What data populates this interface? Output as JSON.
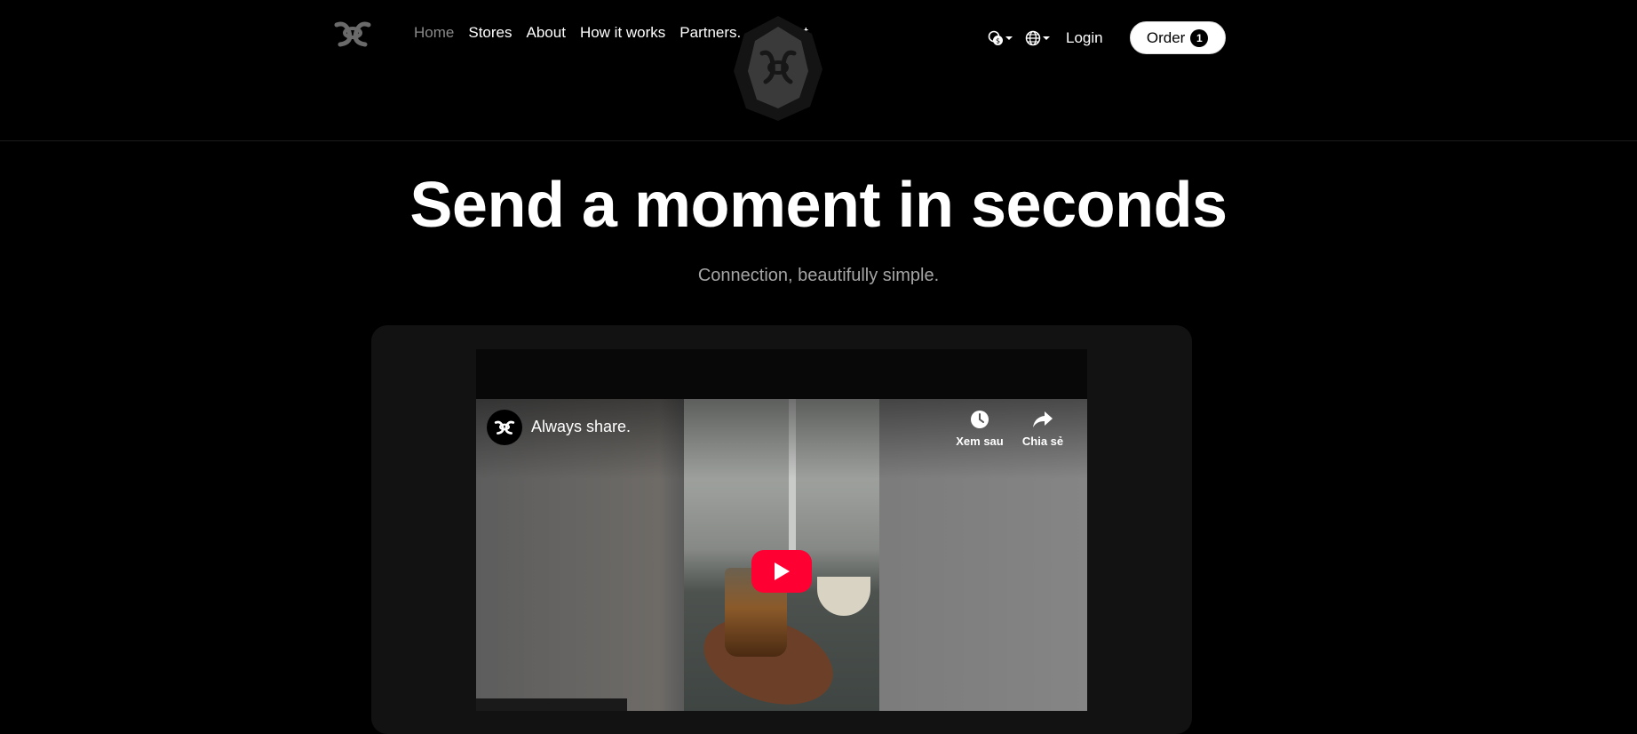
{
  "nav": {
    "logo_icon": "xoxo-logo",
    "items": [
      {
        "label": "Home",
        "active": true
      },
      {
        "label": "Stores"
      },
      {
        "label": "About"
      },
      {
        "label": "How it works"
      },
      {
        "label": "Partners."
      },
      {
        "label": "Support"
      }
    ],
    "currency_icon": "currency-icon",
    "language_icon": "globe-icon",
    "login_label": "Login",
    "order_label": "Order",
    "order_count": "1"
  },
  "hero": {
    "title": "Send a moment in seconds",
    "subtitle": "Connection, beautifully simple."
  },
  "video": {
    "title": "Always share.",
    "watch_later_label": "Xem sau",
    "share_label": "Chia sẻ",
    "play_icon": "play-icon",
    "accent": "#ff0033"
  }
}
